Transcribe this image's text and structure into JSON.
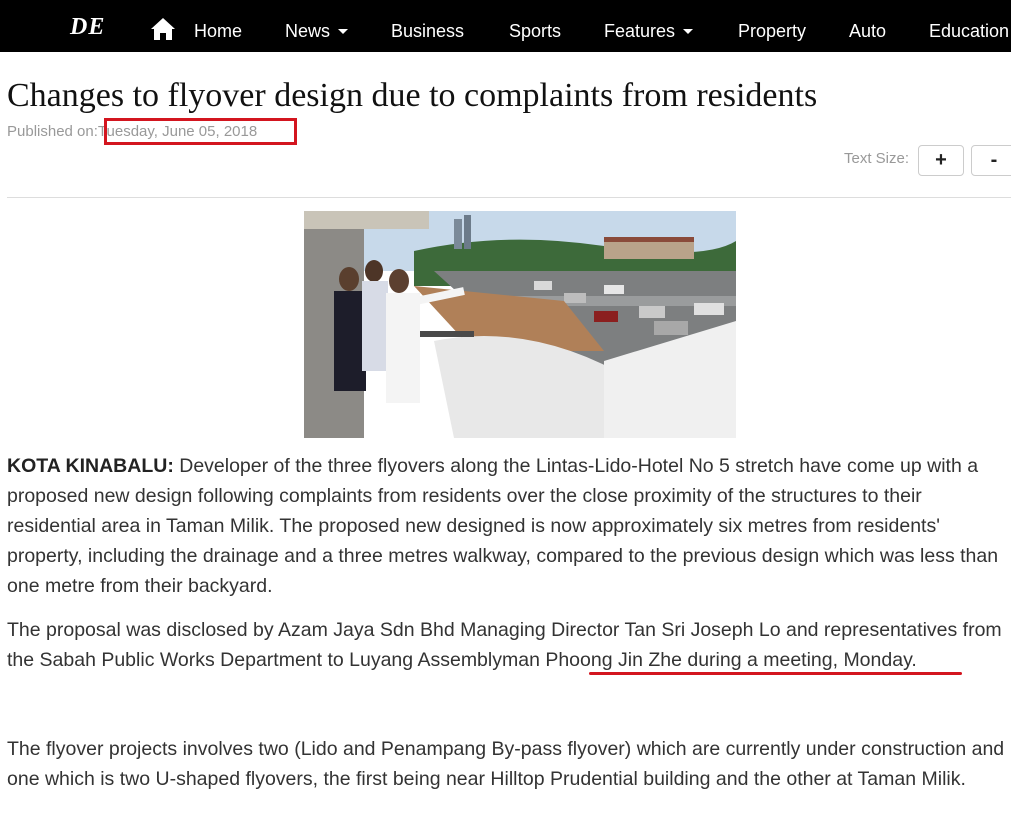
{
  "nav": {
    "logo": "DE",
    "items": [
      {
        "label": "Home",
        "dropdown": false
      },
      {
        "label": "News",
        "dropdown": true
      },
      {
        "label": "Business",
        "dropdown": false
      },
      {
        "label": "Sports",
        "dropdown": false
      },
      {
        "label": "Features",
        "dropdown": true
      },
      {
        "label": "Property",
        "dropdown": false
      },
      {
        "label": "Auto",
        "dropdown": false
      },
      {
        "label": "Education",
        "dropdown": false
      }
    ]
  },
  "article": {
    "title": "Changes to flyover design due to complaints from residents",
    "published_label": "Published on:",
    "published_date": "Tuesday, June 05, 2018",
    "text_size_label": "Text Size:",
    "text_size_increase": "+",
    "text_size_decrease": "-",
    "lead": "KOTA KINABALU:",
    "p1": "Developer of the three flyovers along the Lintas-Lido-Hotel No 5 stretch have come up with a proposed new design following complaints from residents over the close proximity of the structures to their residential area in Taman Milik. The proposed new designed is now approximately six metres from residents' property, including the drainage and a three metres walkway, compared to the previous design which was less than one metre from their backyard.",
    "p2": "The proposal was disclosed by Azam Jaya Sdn Bhd Managing Director Tan Sri Joseph Lo and representatives from the Sabah Public Works Department to Luyang Assemblyman Phoong Jin Zhe during a meeting, Monday.",
    "p3": "The flyover projects involves two (Lido and Penampang By-pass flyover) which are currently under construction and one which is two U-shaped flyovers, the first being near Hilltop Prudential building and the other at Taman Milik."
  },
  "colors": {
    "nav_bg": "#000000",
    "highlight": "#d3151f"
  },
  "icons": [
    "home-icon",
    "chevron-down-icon"
  ]
}
